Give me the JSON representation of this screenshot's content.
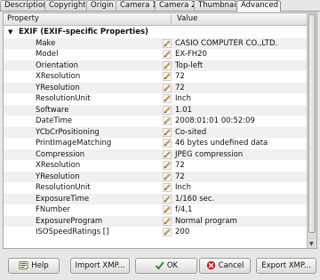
{
  "tabs": [
    {
      "label": "Description"
    },
    {
      "label": "Copyright"
    },
    {
      "label": "Origin"
    },
    {
      "label": "Camera 1"
    },
    {
      "label": "Camera 2"
    },
    {
      "label": "Thumbnail"
    },
    {
      "label": "Advanced",
      "active": true
    }
  ],
  "table": {
    "col_property": "Property",
    "col_value": "Value",
    "group_label": "EXIF (EXIF-specific Properties)",
    "rows": [
      {
        "property": "Make",
        "value": "CASIO COMPUTER CO.,LTD."
      },
      {
        "property": "Model",
        "value": "EX-FH20"
      },
      {
        "property": "Orientation",
        "value": "Top-left"
      },
      {
        "property": "XResolution",
        "value": "72"
      },
      {
        "property": "YResolution",
        "value": "72"
      },
      {
        "property": "ResolutionUnit",
        "value": "Inch"
      },
      {
        "property": "Software",
        "value": "1.01"
      },
      {
        "property": "DateTime",
        "value": "2008:01:01 00:52:09"
      },
      {
        "property": "YCbCrPositioning",
        "value": "Co-sited"
      },
      {
        "property": "PrintImageMatching",
        "value": "46 bytes undefined data"
      },
      {
        "property": "Compression",
        "value": "JPEG compression"
      },
      {
        "property": "XResolution",
        "value": "72"
      },
      {
        "property": "YResolution",
        "value": "72"
      },
      {
        "property": "ResolutionUnit",
        "value": "Inch"
      },
      {
        "property": "ExposureTime",
        "value": "1/160 sec."
      },
      {
        "property": "FNumber",
        "value": "f/4,1"
      },
      {
        "property": "ExposureProgram",
        "value": "Normal program"
      },
      {
        "property": "ISOSpeedRatings []",
        "value": "200"
      }
    ]
  },
  "buttons": {
    "help": "Help",
    "import": "Import XMP...",
    "ok": "OK",
    "cancel": "Cancel",
    "export": "Export XMP..."
  },
  "icons": {
    "edit": "pencil-icon",
    "help": "help-icon",
    "ok": "checkmark-icon",
    "cancel": "cancel-icon"
  },
  "colors": {
    "ok_green": "#2f8f2f",
    "cancel_red": "#cc2222",
    "help_blue": "#3465a4"
  }
}
